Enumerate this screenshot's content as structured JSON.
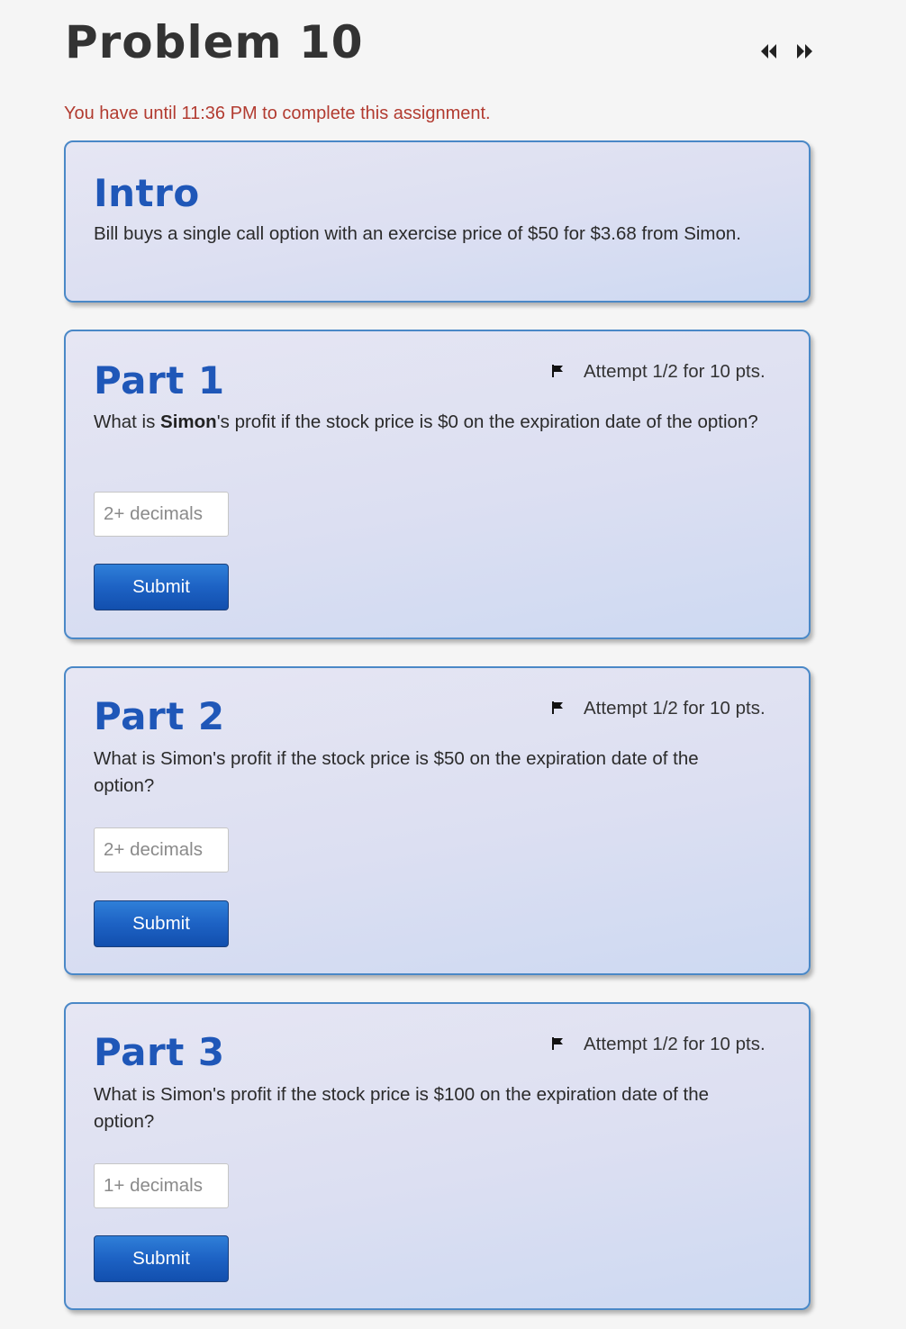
{
  "page": {
    "title": "Problem 10",
    "deadline": "You have until 11:36 PM to complete this assignment."
  },
  "nav": {
    "prev_icon": "rewind-icon",
    "next_icon": "fast-forward-icon"
  },
  "intro": {
    "heading": "Intro",
    "text": "Bill buys a single call option with an exercise price of $50 for $3.68 from Simon."
  },
  "parts": [
    {
      "heading": "Part 1",
      "attempt": "Attempt 1/2 for 10 pts.",
      "question_prefix": "What is ",
      "question_bold": "Simon",
      "question_suffix": "'s profit if the stock price is $0 on the expiration date of the option?",
      "input_value": "",
      "input_placeholder": "2+ decimals",
      "submit_label": "Submit"
    },
    {
      "heading": "Part 2",
      "attempt": "Attempt 1/2 for 10 pts.",
      "question": "What is Simon's profit if the stock price is $50 on the expiration date of the option?",
      "input_value": "",
      "input_placeholder": "2+ decimals",
      "submit_label": "Submit"
    },
    {
      "heading": "Part 3",
      "attempt": "Attempt 1/2 for 10 pts.",
      "question": "What is Simon's profit if the stock price is $100 on the expiration date of the option?",
      "input_value": "",
      "input_placeholder": "1+ decimals",
      "submit_label": "Submit"
    }
  ],
  "colors": {
    "heading_blue": "#1f57b8",
    "deadline_red": "#b23b30",
    "card_border": "#4a88c7",
    "button_blue": "#1d62c4"
  }
}
